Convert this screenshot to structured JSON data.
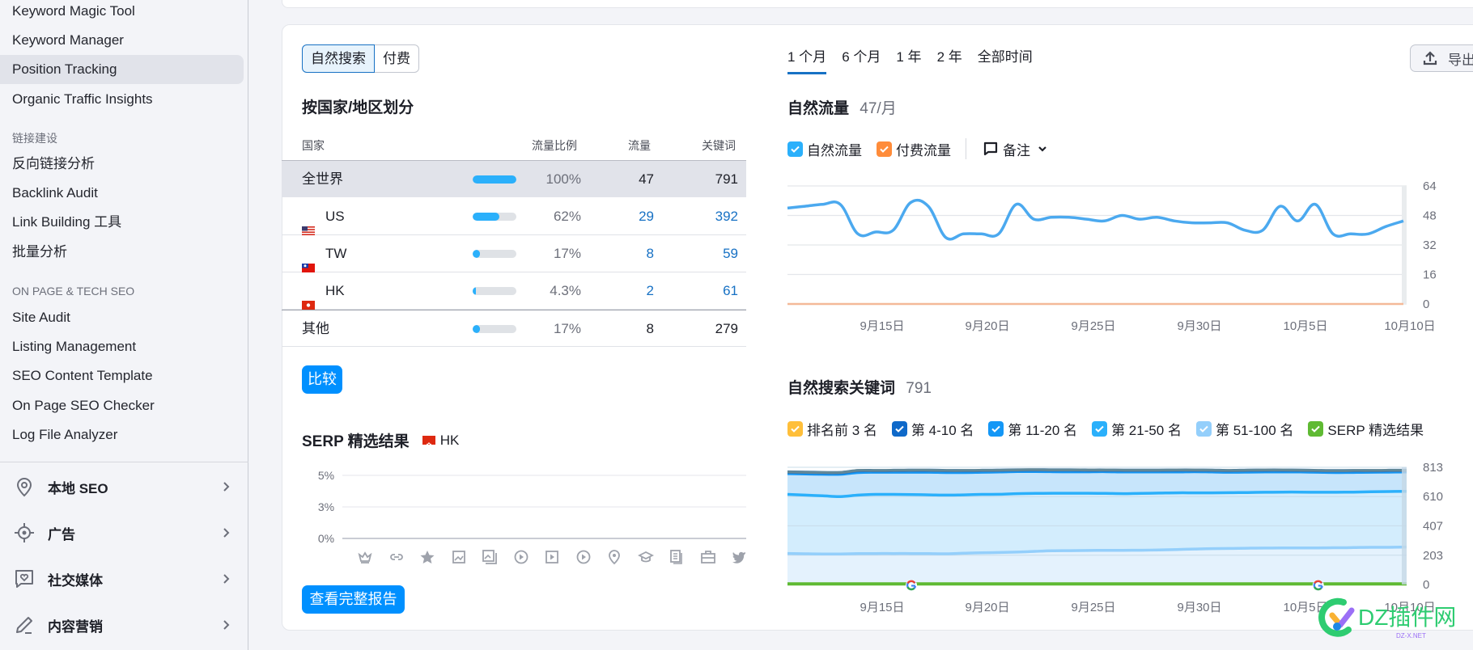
{
  "sidebar": {
    "items_top": [
      {
        "label": "Keyword Magic Tool",
        "active": false
      },
      {
        "label": "Keyword Manager",
        "active": false
      },
      {
        "label": "Position Tracking",
        "active": true
      },
      {
        "label": "Organic Traffic Insights",
        "active": false
      }
    ],
    "section_links": "链接建设",
    "items_links": [
      {
        "label": "反向链接分析"
      },
      {
        "label": "Backlink Audit"
      },
      {
        "label": "Link Building 工具"
      },
      {
        "label": "批量分析"
      }
    ],
    "section_onpage": "ON PAGE & TECH SEO",
    "items_onpage": [
      {
        "label": "Site Audit"
      },
      {
        "label": "Listing Management"
      },
      {
        "label": "SEO Content Template"
      },
      {
        "label": "On Page SEO Checker"
      },
      {
        "label": "Log File Analyzer"
      }
    ],
    "groups": [
      {
        "label": "本地 SEO",
        "icon": "location-pin-icon"
      },
      {
        "label": "广告",
        "icon": "target-icon"
      },
      {
        "label": "社交媒体",
        "icon": "social-chat-icon"
      },
      {
        "label": "内容营销",
        "icon": "pencil-icon"
      }
    ]
  },
  "main": {
    "segment": {
      "organic": "自然搜索",
      "paid": "付费"
    },
    "country_title": "按国家/地区划分",
    "table": {
      "headers": {
        "country": "国家",
        "share": "流量比例",
        "traffic": "流量",
        "keywords": "关键词"
      },
      "rows": [
        {
          "country": "全世界",
          "flag": "",
          "share_pct": 100,
          "share": "100%",
          "traffic": "47",
          "keywords": "791"
        },
        {
          "country": "US",
          "flag": "us",
          "share_pct": 62,
          "share": "62%",
          "traffic": "29",
          "keywords": "392"
        },
        {
          "country": "TW",
          "flag": "tw",
          "share_pct": 17,
          "share": "17%",
          "traffic": "8",
          "keywords": "59"
        },
        {
          "country": "HK",
          "flag": "hk",
          "share_pct": 4.3,
          "share": "4.3%",
          "traffic": "2",
          "keywords": "61"
        },
        {
          "country": "其他",
          "flag": "",
          "share_pct": 17,
          "share": "17%",
          "traffic": "8",
          "keywords": "279"
        }
      ]
    },
    "compare_button": "比较",
    "serp": {
      "title": "SERP 精选结果",
      "country": "HK",
      "y_ticks": [
        "5%",
        "3%",
        "0%"
      ],
      "feature_icons": [
        "crown-icon",
        "link-icon",
        "star-icon",
        "image-icon",
        "image-pack-icon",
        "video-play-icon",
        "video-icon",
        "play-circle-icon",
        "location-pin-icon",
        "graduation-cap-icon",
        "news-icon",
        "briefcase-icon",
        "twitter-icon"
      ],
      "full_report_button": "查看完整报告"
    },
    "time_tabs": [
      {
        "label": "1 个月",
        "active": true
      },
      {
        "label": "6 个月",
        "active": false
      },
      {
        "label": "1 年",
        "active": false
      },
      {
        "label": "2 年",
        "active": false
      },
      {
        "label": "全部时间",
        "active": false
      }
    ],
    "export_label": "导出",
    "traffic_title": "自然流量",
    "traffic_value": "47/月",
    "traffic_legend": {
      "organic": "自然流量",
      "paid": "付费流量",
      "notes": "备注"
    },
    "keywords_title": "自然搜索关键词",
    "keywords_value": "791",
    "keywords_legend": [
      {
        "label": "排名前 3 名",
        "color": "#ffbf3a"
      },
      {
        "label": "第 4-10 名",
        "color": "#0f69c9"
      },
      {
        "label": "第 11-20 名",
        "color": "#1497f6"
      },
      {
        "label": "第 21-50 名",
        "color": "#2bb0fb"
      },
      {
        "label": "第 51-100 名",
        "color": "#94cffb"
      },
      {
        "label": "SERP 精选结果",
        "color": "#5fba33"
      }
    ]
  },
  "colors": {
    "accent": "#1771c4",
    "button": "#0090ff",
    "organic": "#4ba9ef",
    "paid": "#ff8c3a"
  },
  "chart_data": [
    {
      "type": "line",
      "title": "自然流量",
      "x_ticks": [
        "9月15日",
        "9月20日",
        "9月25日",
        "9月30日",
        "10月5日",
        "10月10日"
      ],
      "ylim": [
        0,
        64
      ],
      "y_ticks": [
        64,
        48,
        32,
        16,
        0
      ],
      "series": [
        {
          "name": "自然流量",
          "color": "#4ba9ef",
          "values": [
            52,
            53,
            54,
            54,
            38,
            39,
            40,
            55,
            53,
            36,
            38,
            38,
            38,
            54,
            46,
            47,
            47,
            46,
            45,
            48,
            46,
            47,
            45,
            44,
            44,
            44,
            40,
            40,
            53,
            45,
            54,
            38,
            38,
            38,
            42,
            45
          ]
        },
        {
          "name": "付费流量",
          "color": "#f4b998",
          "values": [
            0,
            0,
            0,
            0,
            0,
            0,
            0,
            0,
            0,
            0,
            0,
            0,
            0,
            0,
            0,
            0,
            0,
            0,
            0,
            0,
            0,
            0,
            0,
            0,
            0,
            0,
            0,
            0,
            0,
            0,
            0,
            0,
            0,
            0,
            0,
            0
          ]
        }
      ],
      "grid": true
    },
    {
      "type": "area",
      "title": "自然搜索关键词",
      "x_ticks": [
        "9月15日",
        "9月20日",
        "9月25日",
        "9月30日",
        "10月5日",
        "10月10日"
      ],
      "ylim": [
        0,
        813
      ],
      "y_ticks": [
        813,
        610,
        407,
        203,
        0
      ],
      "series": [
        {
          "name": "SERP 精选结果",
          "color": "#5fba33",
          "values": [
            4,
            4,
            4,
            4,
            4,
            4,
            4,
            4,
            4,
            4,
            4,
            4,
            4,
            4,
            4,
            4,
            4,
            4,
            4,
            4,
            4,
            4,
            4,
            4,
            4,
            4,
            4,
            4,
            4,
            4,
            4,
            4,
            4,
            4,
            4,
            4
          ]
        },
        {
          "name": "第 51-100 名",
          "color": "#94cffb",
          "values": [
            215,
            213,
            212,
            212,
            214,
            215,
            215,
            215,
            214,
            213,
            217,
            220,
            222,
            225,
            230,
            234,
            235,
            236,
            237,
            237,
            238,
            240,
            243,
            246,
            249,
            250,
            252,
            253,
            254,
            254,
            254,
            255,
            256,
            258,
            258,
            260
          ]
        },
        {
          "name": "第 21-50 名",
          "color": "#2bb0fb",
          "values": [
            625,
            620,
            615,
            610,
            620,
            625,
            625,
            624,
            622,
            620,
            622,
            625,
            626,
            630,
            632,
            633,
            633,
            633,
            632,
            630,
            632,
            634,
            636,
            636,
            636,
            637,
            638,
            640,
            641,
            641,
            640,
            640,
            641,
            643,
            645,
            646
          ]
        },
        {
          "name": "第 11-20 名",
          "color": "#1497f6",
          "values": [
            770,
            768,
            766,
            766,
            778,
            780,
            780,
            780,
            780,
            778,
            778,
            780,
            782,
            785,
            785,
            784,
            783,
            783,
            784,
            782,
            782,
            782,
            782,
            784,
            782,
            780,
            781,
            782,
            782,
            782,
            780,
            778,
            779,
            780,
            781,
            782
          ]
        },
        {
          "name": "第 4-10 名",
          "color": "#0f69c9",
          "values": [
            780,
            778,
            776,
            776,
            790,
            790,
            791,
            792,
            792,
            790,
            790,
            791,
            792,
            794,
            795,
            794,
            794,
            793,
            793,
            792,
            792,
            792,
            793,
            793,
            792,
            790,
            792,
            793,
            793,
            792,
            790,
            789,
            790,
            790,
            791,
            791
          ]
        },
        {
          "name": "排名前 3 名",
          "color": "#ffbf3a",
          "values": [
            781,
            779,
            777,
            777,
            791,
            791,
            792,
            793,
            793,
            791,
            791,
            792,
            793,
            795,
            796,
            795,
            795,
            794,
            794,
            793,
            793,
            793,
            794,
            794,
            793,
            791,
            793,
            794,
            794,
            793,
            791,
            790,
            791,
            791,
            792,
            792
          ]
        }
      ],
      "annotations": [
        {
          "type": "google-update-marker",
          "x_index": 7
        },
        {
          "type": "google-update-marker",
          "x_index": 30
        }
      ],
      "grid": true
    }
  ]
}
